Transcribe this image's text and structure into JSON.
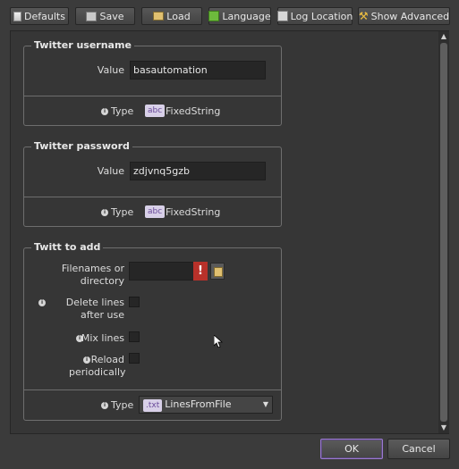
{
  "toolbar": {
    "defaults": "Defaults",
    "save": "Save",
    "load": "Load",
    "language": "Language",
    "log_location": "Log Location",
    "show_advanced": "Show Advanced"
  },
  "groups": {
    "username": {
      "title": "Twitter username",
      "value_label": "Value",
      "value": "basautomation",
      "type_label": "Type",
      "type_badge": "abc",
      "type_value": "FixedString"
    },
    "password": {
      "title": "Twitter password",
      "value_label": "Value",
      "value": "zdjvnq5gzb",
      "type_label": "Type",
      "type_badge": "abc",
      "type_value": "FixedString"
    },
    "twitt": {
      "title": "Twitt to add",
      "filenames_label": "Filenames or directory",
      "filenames_value": "",
      "error_glyph": "!",
      "delete_lines_label": "Delete lines after use",
      "mix_lines_label": "Mix lines",
      "reload_label": "Reload periodically",
      "type_label": "Type",
      "type_badge": ".txt",
      "type_value": "LinesFromFile"
    }
  },
  "footer": {
    "ok": "OK",
    "cancel": "Cancel"
  },
  "icons": {
    "info": "info-icon",
    "error": "error-icon",
    "folder": "folder-icon"
  },
  "colors": {
    "background": "#3b3b3b",
    "error": "#b8312a",
    "badge_bg": "#d8d0e8",
    "ok_border": "#9a7ad0"
  }
}
